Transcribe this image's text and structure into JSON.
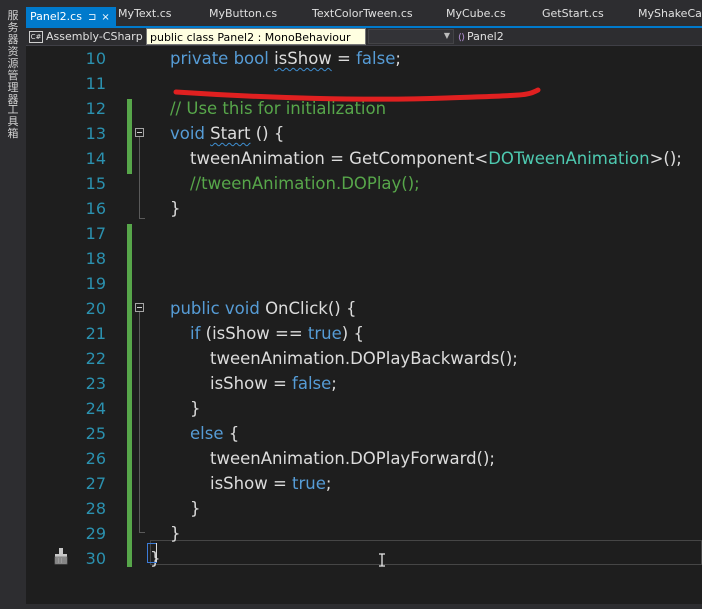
{
  "sidebar": {
    "panels": [
      {
        "label": "服务器资源管理器"
      },
      {
        "label": "工具箱"
      }
    ]
  },
  "tabs": [
    {
      "label": "Panel2.cs",
      "active": true
    },
    {
      "label": "MyText.cs"
    },
    {
      "label": "MyButton.cs"
    },
    {
      "label": "TextColorTween.cs"
    },
    {
      "label": "MyCube.cs"
    },
    {
      "label": "GetStart.cs"
    },
    {
      "label": "MyShakeCam"
    }
  ],
  "tab_pin_glyph": "⊐",
  "tab_close_glyph": "×",
  "navbar": {
    "project_badge": "C#",
    "project": "Assembly-CSharp",
    "class_tooltip": "public class Panel2 : MonoBehaviour",
    "member_icon": "⟨⟩",
    "member": "Panel2"
  },
  "editor": {
    "line_numbers": [
      "10",
      "11",
      "12",
      "13",
      "14",
      "15",
      "16",
      "17",
      "18",
      "19",
      "20",
      "21",
      "22",
      "23",
      "24",
      "25",
      "26",
      "27",
      "28",
      "29",
      "30"
    ],
    "lines": [
      {
        "tokens": [
          {
            "t": "private bool ",
            "c": "kw"
          },
          {
            "t": "isShow",
            "c": "pl",
            "sq": true
          },
          {
            "t": " = ",
            "c": "pl"
          },
          {
            "t": "false",
            "c": "kw"
          },
          {
            "t": ";",
            "c": "pl"
          }
        ],
        "indent": 1
      },
      {
        "tokens": [],
        "indent": 0
      },
      {
        "tokens": [
          {
            "t": "// Use this for initialization",
            "c": "cm"
          }
        ],
        "indent": 1
      },
      {
        "tokens": [
          {
            "t": "void ",
            "c": "kw"
          },
          {
            "t": "Start",
            "c": "pl",
            "sq": true
          },
          {
            "t": " () {",
            "c": "pl"
          }
        ],
        "indent": 1
      },
      {
        "tokens": [
          {
            "t": "tweenAnimation = GetComponent<",
            "c": "pl"
          },
          {
            "t": "DOTweenAnimation",
            "c": "tp"
          },
          {
            "t": ">();",
            "c": "pl"
          }
        ],
        "indent": 2
      },
      {
        "tokens": [
          {
            "t": "//tweenAnimation.DOPlay();",
            "c": "cm"
          }
        ],
        "indent": 2
      },
      {
        "tokens": [
          {
            "t": "}",
            "c": "pl"
          }
        ],
        "indent": 1
      },
      {
        "tokens": [],
        "indent": 0
      },
      {
        "tokens": [],
        "indent": 0
      },
      {
        "tokens": [],
        "indent": 0
      },
      {
        "tokens": [
          {
            "t": "public void ",
            "c": "kw"
          },
          {
            "t": "OnClick() {",
            "c": "pl"
          }
        ],
        "indent": 1
      },
      {
        "tokens": [
          {
            "t": "if ",
            "c": "kw"
          },
          {
            "t": "(isShow == ",
            "c": "pl"
          },
          {
            "t": "true",
            "c": "kw"
          },
          {
            "t": ") {",
            "c": "pl"
          }
        ],
        "indent": 2
      },
      {
        "tokens": [
          {
            "t": "tweenAnimation.DOPlayBackwards();",
            "c": "pl"
          }
        ],
        "indent": 3
      },
      {
        "tokens": [
          {
            "t": "isShow = ",
            "c": "pl"
          },
          {
            "t": "false",
            "c": "kw"
          },
          {
            "t": ";",
            "c": "pl"
          }
        ],
        "indent": 3
      },
      {
        "tokens": [
          {
            "t": "}",
            "c": "pl"
          }
        ],
        "indent": 2
      },
      {
        "tokens": [
          {
            "t": "else ",
            "c": "kw"
          },
          {
            "t": "{",
            "c": "pl"
          }
        ],
        "indent": 2
      },
      {
        "tokens": [
          {
            "t": "tweenAnimation.DOPlayForward();",
            "c": "pl"
          }
        ],
        "indent": 3
      },
      {
        "tokens": [
          {
            "t": "isShow = ",
            "c": "pl"
          },
          {
            "t": "true",
            "c": "kw"
          },
          {
            "t": ";",
            "c": "pl"
          }
        ],
        "indent": 3
      },
      {
        "tokens": [
          {
            "t": "}",
            "c": "pl"
          }
        ],
        "indent": 2
      },
      {
        "tokens": [
          {
            "t": "}",
            "c": "pl"
          }
        ],
        "indent": 1
      },
      {
        "tokens": [
          {
            "t": "}",
            "c": "pl"
          }
        ],
        "indent": 0
      }
    ]
  },
  "colors": {
    "accent": "#007acc",
    "change_bar": "#57a64a",
    "annotation_stroke": "#e02020"
  }
}
